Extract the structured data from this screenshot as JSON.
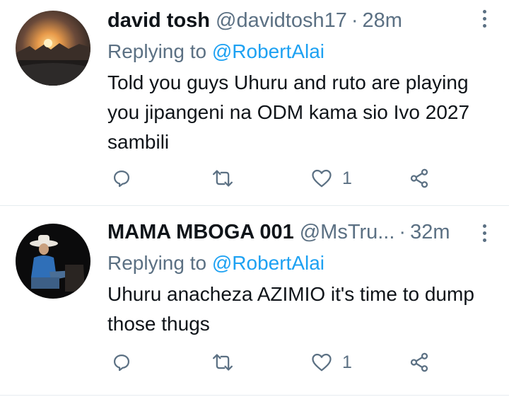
{
  "tweets": [
    {
      "name": "david tosh",
      "handle": "@davidtosh17",
      "separator": "·",
      "time": "28m",
      "replying_prefix": "Replying to",
      "replying_to": "@RobertAlai",
      "text": "Told you guys Uhuru and ruto are playing you jipangeni na ODM kama sio Ivo 2027 sambili",
      "like_count": "1",
      "avatar_icon": "sunset-street-photo-avatar"
    },
    {
      "name": "MAMA MBOGA 001",
      "handle": "@MsTru...",
      "separator": "·",
      "time": "32m",
      "replying_prefix": "Replying to",
      "replying_to": "@RobertAlai",
      "text": "Uhuru anacheza AZIMIO  it's time to dump those thugs",
      "like_count": "1",
      "avatar_icon": "cowboy-seated-photo-avatar"
    }
  ],
  "colors": {
    "secondary_text": "#5b7083",
    "link": "#1da1f2",
    "divider": "#e6ecf0"
  }
}
